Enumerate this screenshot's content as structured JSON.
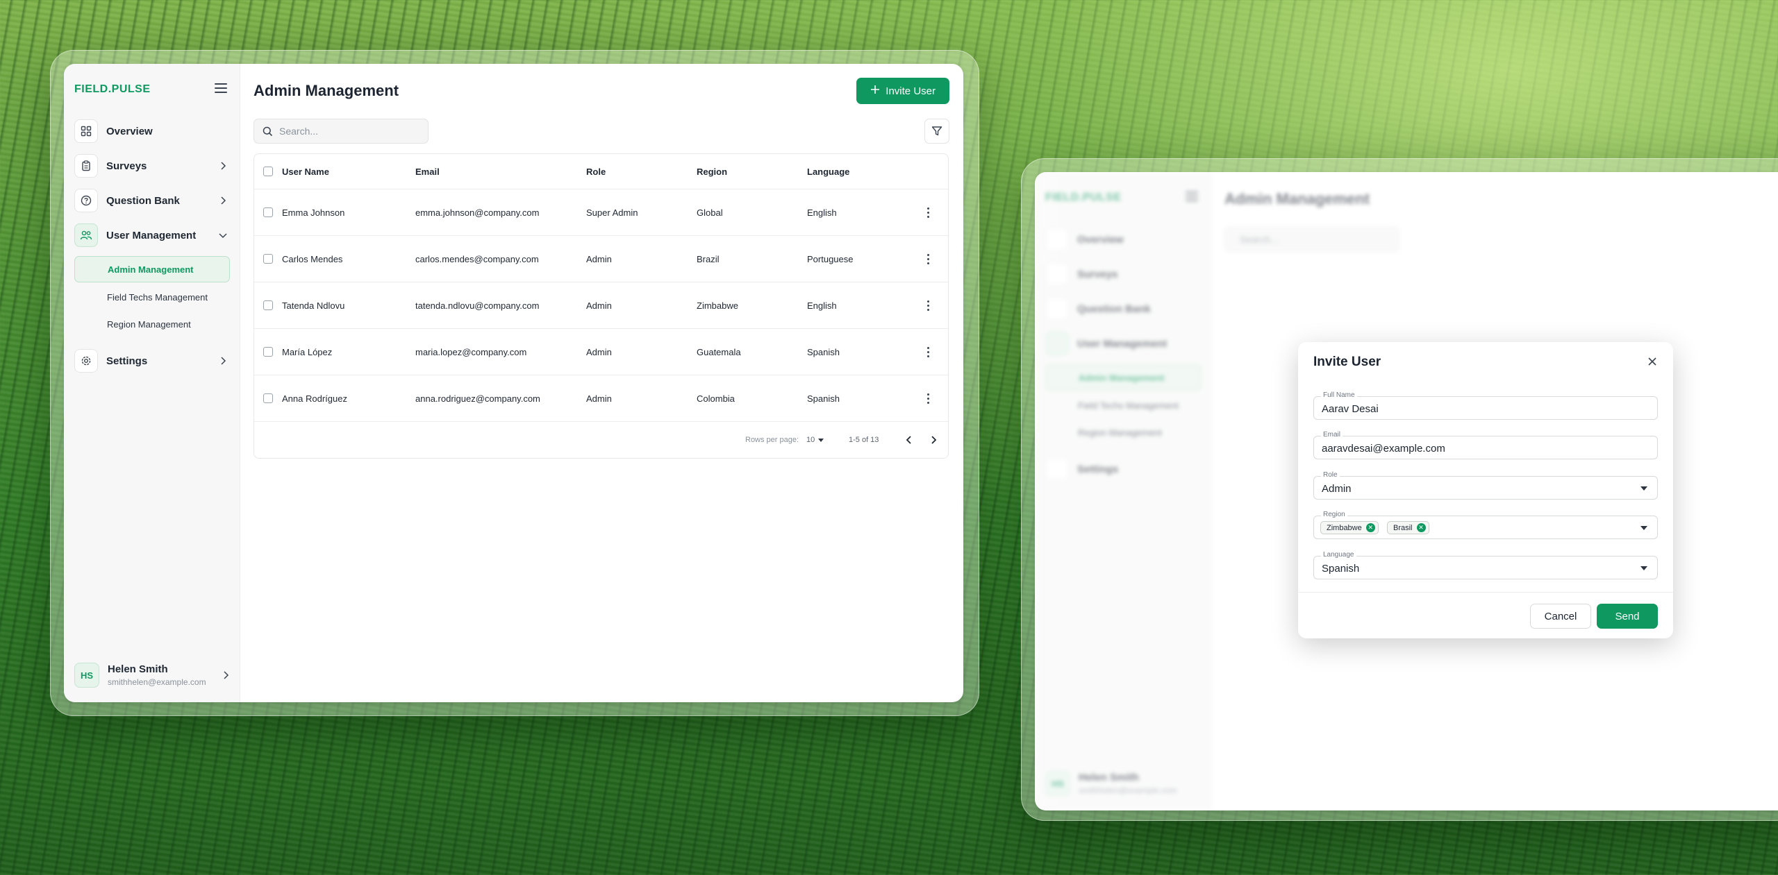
{
  "app": {
    "logo": "FIELD.PULSE",
    "nav": [
      {
        "label": "Overview",
        "icon": "grid-icon"
      },
      {
        "label": "Surveys",
        "icon": "clipboard-icon"
      },
      {
        "label": "Question Bank",
        "icon": "question-circle-icon"
      },
      {
        "label": "User Management",
        "icon": "users-icon"
      },
      {
        "label": "Settings",
        "icon": "gear-icon"
      }
    ],
    "subnav": [
      {
        "label": "Admin Management"
      },
      {
        "label": "Field Techs Management"
      },
      {
        "label": "Region Management"
      }
    ],
    "user": {
      "initials": "HS",
      "name": "Helen Smith",
      "email": "smithhelen@example.com"
    }
  },
  "page": {
    "title": "Admin Management",
    "invite_label": "Invite User",
    "search_placeholder": "Search..."
  },
  "table": {
    "columns": [
      "User Name",
      "Email",
      "Role",
      "Region",
      "Language"
    ],
    "rows": [
      [
        "Emma Johnson",
        "emma.johnson@company.com",
        "Super Admin",
        "Global",
        "English"
      ],
      [
        "Carlos Mendes",
        "carlos.mendes@company.com",
        "Admin",
        "Brazil",
        "Portuguese"
      ],
      [
        "Tatenda Ndlovu",
        "tatenda.ndlovu@company.com",
        "Admin",
        "Zimbabwe",
        "English"
      ],
      [
        "María López",
        "maria.lopez@company.com",
        "Admin",
        "Guatemala",
        "Spanish"
      ],
      [
        "Anna Rodríguez",
        "anna.rodriguez@company.com",
        "Admin",
        "Colombia",
        "Spanish"
      ]
    ],
    "footer": {
      "rows_per_page_label": "Rows per page:",
      "rows_per_page_value": "10",
      "range": "1-5 of 13"
    }
  },
  "dialog": {
    "title": "Invite User",
    "full_name_label": "Full Name",
    "full_name_value": "Aarav Desai",
    "email_label": "Email",
    "email_value": "aaravdesai@example.com",
    "role_label": "Role",
    "role_value": "Admin",
    "region_label": "Region",
    "region_chips": [
      "Zimbabwe",
      "Brasil"
    ],
    "language_label": "Language",
    "language_value": "Spanish",
    "cancel_label": "Cancel",
    "send_label": "Send"
  },
  "colors": {
    "accent": "#0f9960",
    "accent_light": "#e6f4ec"
  }
}
